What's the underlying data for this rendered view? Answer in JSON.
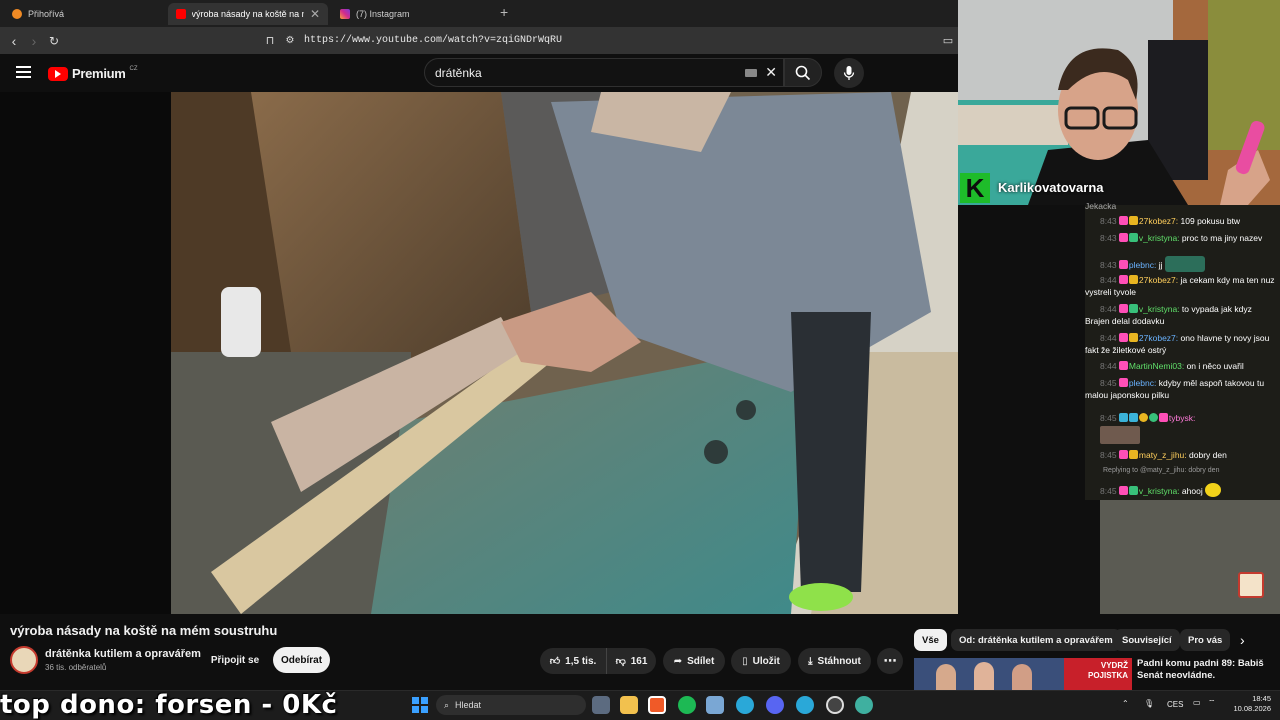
{
  "browser": {
    "tabs": [
      {
        "label": "Přihořívá"
      },
      {
        "label": "výroba násady na koště na mém"
      },
      {
        "label": "(7) Instagram"
      }
    ],
    "new_tab": "+",
    "url": "https://www.youtube.com/watch?v=zqiGNDrWqRU"
  },
  "youtube": {
    "logo_text": "Premium",
    "region": "CZ",
    "search_value": "drátěnka"
  },
  "video": {
    "title": "výroba násady na koště na mém soustruhu",
    "channel": "drátěnka kutilem a opravářem",
    "subscribers": "36 tis. odběratelů",
    "join_label": "Připojit se",
    "subscribe_label": "Odebírat",
    "likes": "1,5 tis.",
    "dislikes": "161",
    "share_label": "Sdílet",
    "save_label": "Uložit",
    "download_label": "Stáhnout",
    "more_label": "⋯"
  },
  "chips": [
    "Vše",
    "Od: drátěnka kutilem a opravářem",
    "Související",
    "Pro vás"
  ],
  "recommendation": {
    "badge_line1": "VYDRŽ",
    "badge_line2": "POJISTKA",
    "line1": "Padni komu padni 89: Babiš",
    "line2": "Senát neovládne."
  },
  "stream": {
    "channel_name": "Karlikovatovarna",
    "badge_letter": "K",
    "overlay_text": "top dono: forsen  -  0Kč"
  },
  "chat": {
    "partial_top": "Jekacka",
    "messages": [
      {
        "ts": "8:43",
        "user": "27kobez7:",
        "text": "109 pokusu btw"
      },
      {
        "ts": "8:43",
        "user": "v_kristyna:",
        "text": "proc to ma jiny nazev"
      },
      {
        "ts": "8:43",
        "user": "plebnc:",
        "text": "jj"
      },
      {
        "ts": "8:44",
        "user": "27kobez7:",
        "text": "ja cekam kdy ma ten nuz vystreli tyvole"
      },
      {
        "ts": "8:44",
        "user": "v_kristyna:",
        "text": "to vypada jak kdyz Brajen delal dodavku"
      },
      {
        "ts": "8:44",
        "user": "27kobez7:",
        "text": "ono hlavne ty novy jsou fakt že žiletkové ostrý"
      },
      {
        "ts": "8:44",
        "user": "MartinNemi03:",
        "text": "on i něco uvařil"
      },
      {
        "ts": "8:45",
        "user": "plebnc:",
        "text": "kdyby měl aspoň takovou tu malou japonskou pilku"
      },
      {
        "ts": "8:45",
        "user": "tybysk:",
        "text": ""
      },
      {
        "ts": "8:45",
        "user": "maty_z_jihu:",
        "text": "dobry den"
      },
      {
        "ts": "",
        "user": "Replying to @maty_z_jihu:",
        "text": "dobry den"
      },
      {
        "ts": "8:45",
        "user": "v_kristyna:",
        "text": "ahooj"
      }
    ]
  },
  "taskbar": {
    "search_label": "Hledat",
    "lang": "CES",
    "time": "18:45",
    "date": "10.08.2026"
  }
}
